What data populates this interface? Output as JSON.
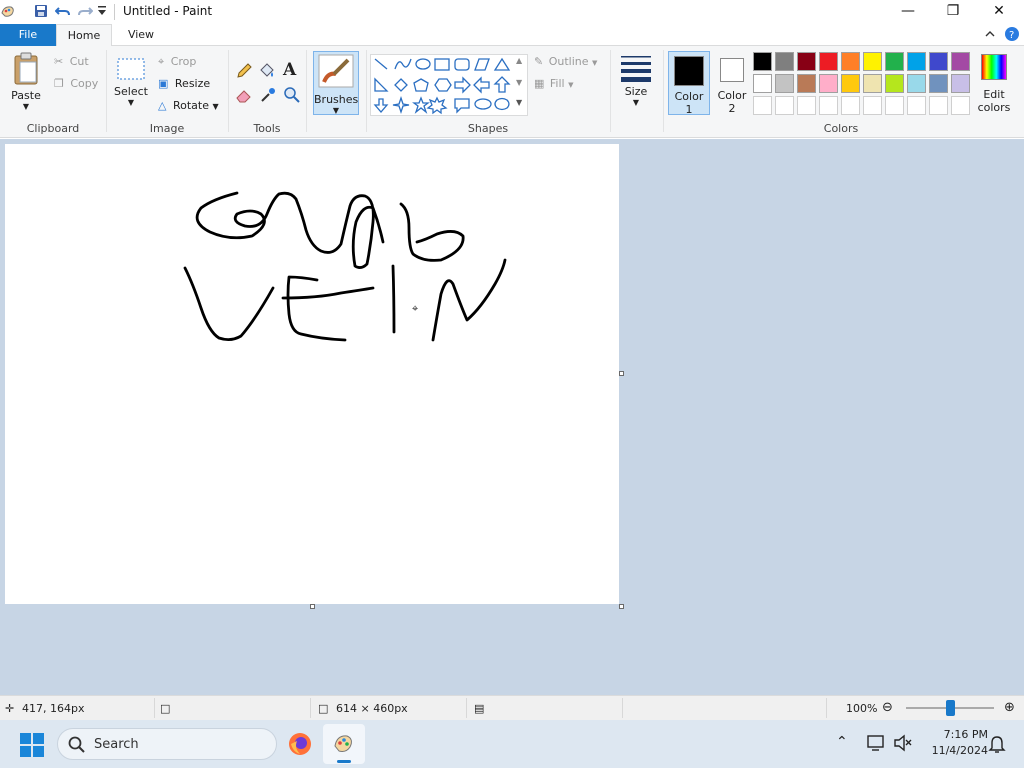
{
  "window": {
    "title": "Untitled - Paint"
  },
  "tabs": {
    "file": "File",
    "home": "Home",
    "view": "View"
  },
  "clipboard": {
    "paste": "Paste",
    "cut": "Cut",
    "copy": "Copy",
    "group": "Clipboard"
  },
  "image": {
    "select": "Select",
    "crop": "Crop",
    "resize": "Resize",
    "rotate": "Rotate",
    "group": "Image"
  },
  "tools": {
    "group": "Tools"
  },
  "brushes": {
    "label": "Brushes"
  },
  "shapes": {
    "outline": "Outline",
    "fill": "Fill",
    "group": "Shapes"
  },
  "size": {
    "label": "Size"
  },
  "color1": {
    "line1": "Color",
    "line2": "1",
    "value": "#000000"
  },
  "color2": {
    "line1": "Color",
    "line2": "2",
    "value": "#ffffff"
  },
  "colors": {
    "group": "Colors",
    "edit_line1": "Edit",
    "edit_line2": "colors",
    "row1": [
      "#000000",
      "#7f7f7f",
      "#880015",
      "#ed1c24",
      "#ff7f27",
      "#fff200",
      "#22b14c",
      "#00a2e8",
      "#3f48cc",
      "#a349a4"
    ],
    "row2": [
      "#ffffff",
      "#c3c3c3",
      "#b97a57",
      "#ffaec9",
      "#ffc90e",
      "#efe4b0",
      "#b5e61d",
      "#99d9ea",
      "#7092be",
      "#c8bfe7"
    ],
    "row3": [
      "#ffffff",
      "#ffffff",
      "#ffffff",
      "#ffffff",
      "#ffffff",
      "#ffffff",
      "#ffffff",
      "#ffffff",
      "#ffffff",
      "#ffffff"
    ]
  },
  "status": {
    "cursor": "417, 164px",
    "canvas_size": "614 × 460px",
    "zoom": "100%",
    "zoom_level": 0.5
  },
  "taskbar": {
    "search": "Search",
    "time": "7:16 PM",
    "date": "11/4/2024"
  }
}
